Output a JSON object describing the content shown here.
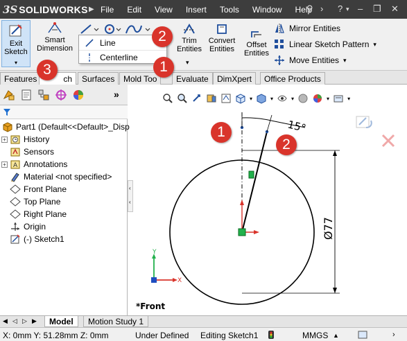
{
  "app": {
    "logo_ds": "3S",
    "logo_name": "SOLIDWORKS"
  },
  "menubar": [
    "File",
    "Edit",
    "View",
    "Insert",
    "Tools",
    "Window",
    "Help"
  ],
  "command_manager": {
    "exit_sketch": [
      "Exit",
      "Sketch"
    ],
    "smart_dimension": [
      "Smart",
      "Dimension"
    ],
    "trim_entities": [
      "Trim",
      "Entities"
    ],
    "convert_entities": [
      "Convert",
      "Entities"
    ],
    "offset_entities": [
      "Offset",
      "Entities"
    ],
    "mirror_entities": "Mirror Entities",
    "linear_sketch_pattern": "Linear Sketch Pattern",
    "move_entities": "Move Entities"
  },
  "line_dropdown": {
    "items": [
      "Line",
      "Centerline"
    ]
  },
  "tabs": [
    "Features",
    "Sketch",
    "Surfaces",
    "Mold Tools",
    "Evaluate",
    "DimXpert",
    "Office Products"
  ],
  "tabs_visible": [
    "Features",
    "ch",
    "Surfaces",
    "Mold Too",
    "Evaluate",
    "DimXpert",
    "Office Products"
  ],
  "active_tab": "Sketch",
  "feature_tree": {
    "items": [
      {
        "label": "Part1  (Default<<Default>_Disp",
        "icon": "part-icon"
      },
      {
        "label": "History",
        "icon": "history-icon"
      },
      {
        "label": "Sensors",
        "icon": "sensors-icon"
      },
      {
        "label": "Annotations",
        "icon": "annotations-icon"
      },
      {
        "label": "Material <not specified>",
        "icon": "material-icon"
      },
      {
        "label": "Front Plane",
        "icon": "plane-icon"
      },
      {
        "label": "Top Plane",
        "icon": "plane-icon"
      },
      {
        "label": "Right Plane",
        "icon": "plane-icon"
      },
      {
        "label": "Origin",
        "icon": "origin-icon"
      },
      {
        "label": "(-) Sketch1",
        "icon": "sketch-icon"
      }
    ]
  },
  "graphics": {
    "angle_dimension": "15°",
    "diameter_dimension": "Ø77",
    "triad_y": "Y",
    "triad_x": "X",
    "view_label": "*Front"
  },
  "bottom_tabs": [
    "Model",
    "Motion Study 1"
  ],
  "status_bar": {
    "coordinates": "X: 0mm Y: 51.28mm Z: 0mm",
    "definition": "Under Defined",
    "mode": "Editing Sketch1",
    "units": "MMGS"
  },
  "callouts": [
    "2",
    "1",
    "3",
    "1",
    "2"
  ],
  "colors": {
    "title_bar": "#3d3d3d",
    "callout": "#d9342b",
    "accent_blue": "#1f4e9c",
    "constraint_green": "#22b14c"
  }
}
